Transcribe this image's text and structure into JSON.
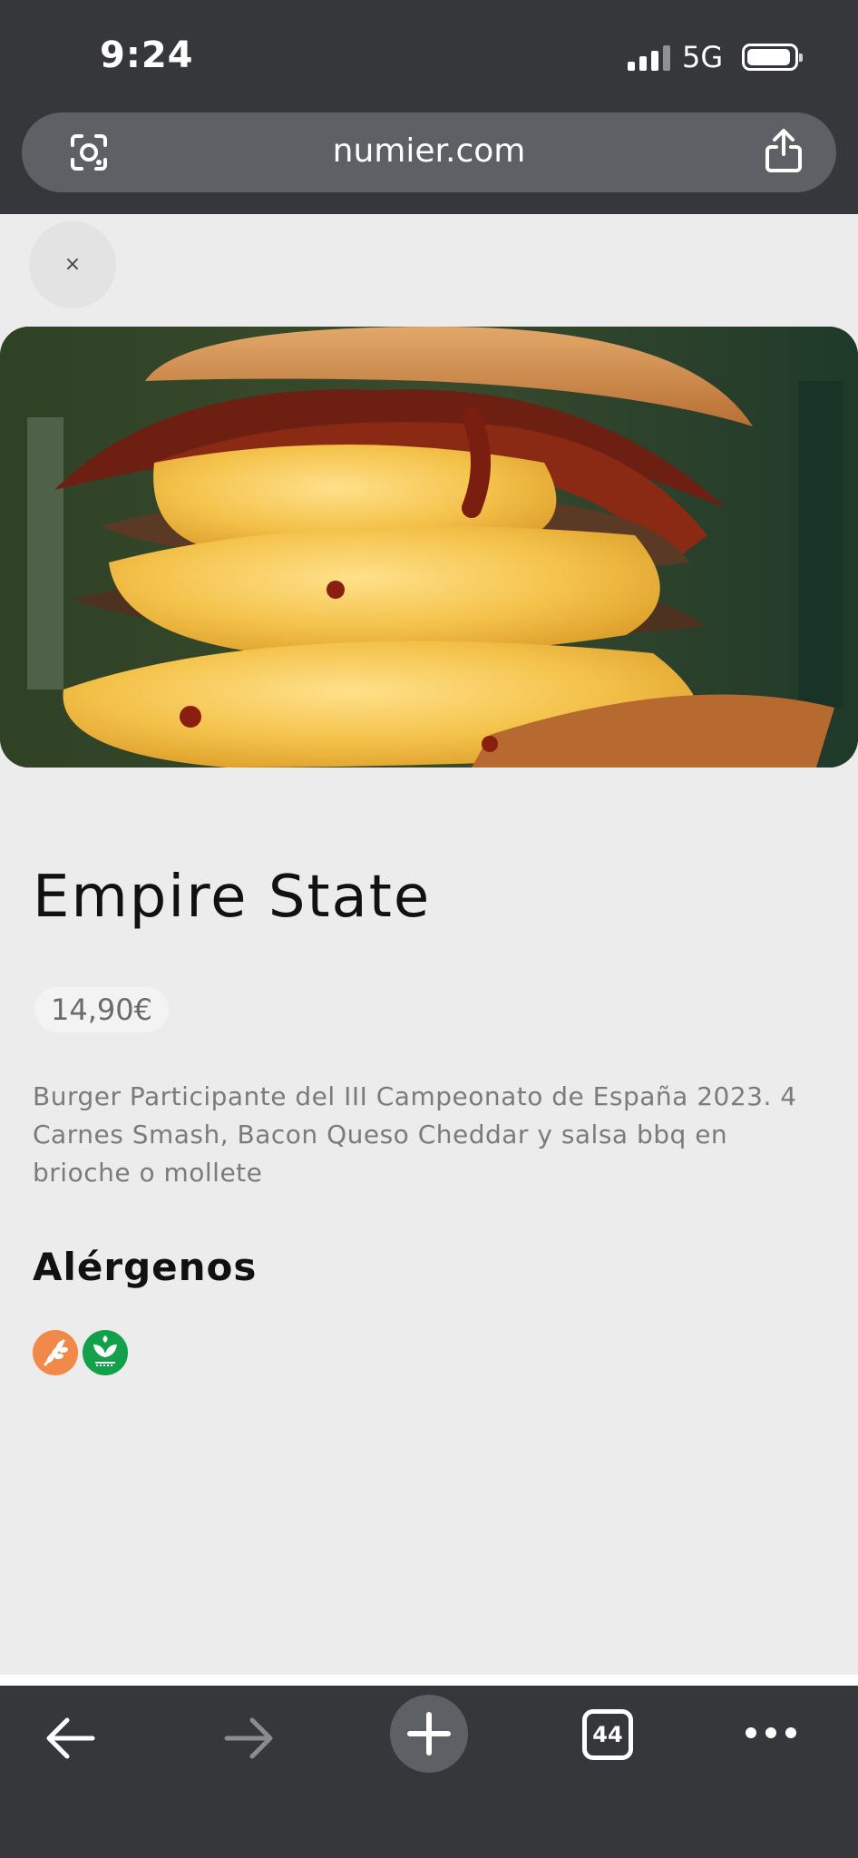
{
  "status_bar": {
    "time": "9:24",
    "network": "5G"
  },
  "browser": {
    "url": "numier.com",
    "lens_icon": "camera-lens-icon",
    "share_icon": "share-icon",
    "tabs_count": "44"
  },
  "page": {
    "close_label": "×",
    "product": {
      "name": "Empire State",
      "price": "14,90€",
      "description": "Burger Participante del III Campeonato de España 2023. 4 Carnes Smash, Bacon Queso Cheddar y salsa bbq en brioche o mollete"
    },
    "allergens": {
      "title": "Alérgenos",
      "items": [
        {
          "icon": "gluten-wheat-icon",
          "color": "#f0894a"
        },
        {
          "icon": "soy-icon",
          "color": "#12a04a"
        }
      ]
    }
  },
  "toolbar": {
    "icons": [
      "back-arrow-icon",
      "forward-arrow-icon",
      "new-tab-plus-icon",
      "tabs-counter-icon",
      "more-dots-icon"
    ]
  }
}
